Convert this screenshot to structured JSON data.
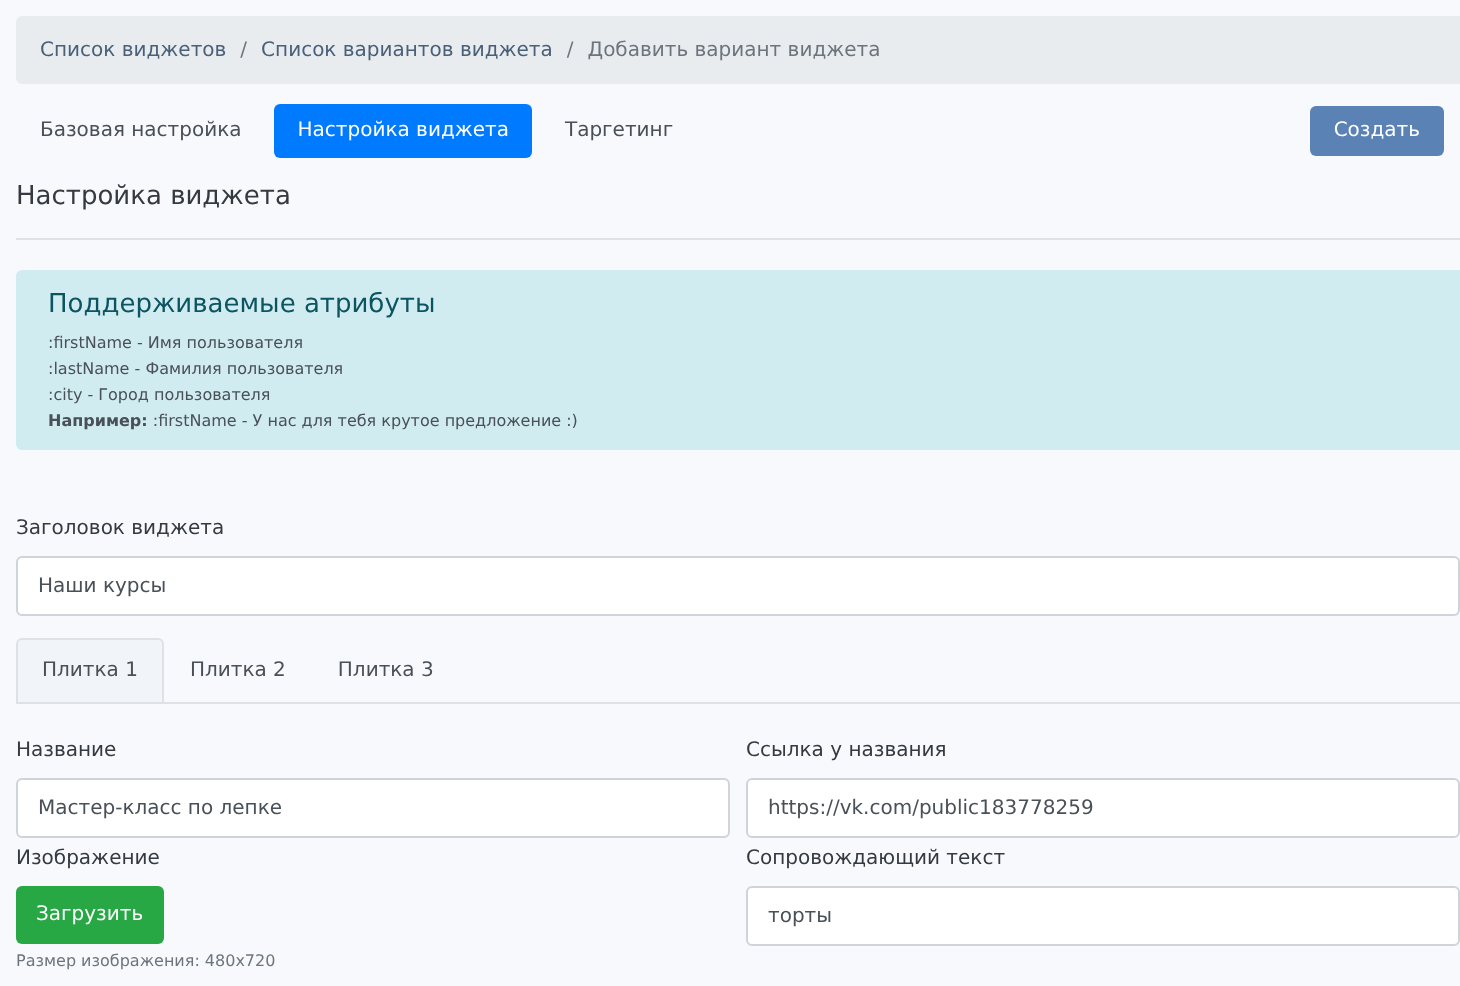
{
  "breadcrumb_separator": "/",
  "breadcrumb": [
    {
      "label": "Список виджетов",
      "kind": "link"
    },
    {
      "label": "Список вариантов виджета",
      "kind": "link"
    },
    {
      "label": "Добавить вариант виджета",
      "kind": "current"
    }
  ],
  "tabs": [
    {
      "label": "Базовая настройка",
      "selected": false
    },
    {
      "label": "Настройка виджета",
      "selected": true
    },
    {
      "label": "Таргетинг",
      "selected": false
    }
  ],
  "create_button": "Создать",
  "section_title": "Настройка виджета",
  "info": {
    "title": "Поддерживаемые атрибуты",
    "lines": [
      ":firstName - Имя пользователя",
      ":lastName - Фамилия пользователя",
      ":city - Город пользователя",
      "**Например:** :firstName - У нас для тебя крутое предложение :)"
    ]
  },
  "widget_title": {
    "label": "Заголовок виджета",
    "value": "Наши курсы"
  },
  "tile_tabs": [
    {
      "label": "Плитка 1",
      "selected": true
    },
    {
      "label": "Плитка 2",
      "selected": false
    },
    {
      "label": "Плитка 3",
      "selected": false
    }
  ],
  "tile": {
    "name": {
      "label": "Название",
      "value": "Мастер-класс по лепке"
    },
    "link": {
      "label": "Ссылка у названия",
      "value": "https://vk.com/public183778259"
    },
    "image": {
      "label": "Изображение",
      "button": "Загрузить",
      "hint": "Размер изображения: 480x720"
    },
    "text": {
      "label": "Сопровождающий текст",
      "value": "торты"
    }
  }
}
